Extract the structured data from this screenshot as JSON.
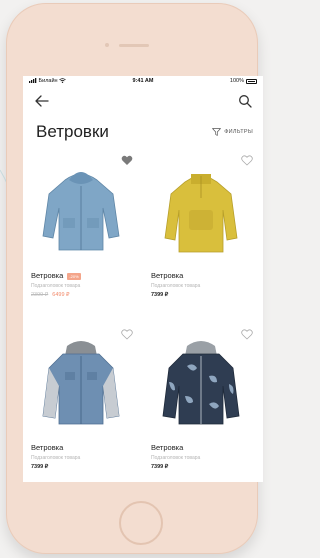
{
  "status_bar": {
    "carrier": "Билайн",
    "time": "9:41 AM",
    "battery": "100%"
  },
  "header": {
    "title": "Ветровки",
    "filter_label": "ФИЛЬТРЫ"
  },
  "products": [
    {
      "name": "Ветровка",
      "subtitle": "Подзаголовок товара",
      "badge": "-20%",
      "old_price": "2399 ₽",
      "price": "6499 ₽",
      "favorited": true
    },
    {
      "name": "Ветровка",
      "subtitle": "Подзаголовок товара",
      "price": "7399 ₽",
      "favorited": false
    },
    {
      "name": "Ветровка",
      "subtitle": "Подзаголовок товара",
      "price": "7399 ₽",
      "favorited": false
    },
    {
      "name": "Ветровка",
      "subtitle": "Подзаголовок товара",
      "price": "7399 ₽",
      "favorited": false
    }
  ],
  "colors": {
    "phone_body": "#f3ddd0",
    "accent_price": "#f28a6b",
    "badge": "#f4a58a",
    "favorite_active": "#7a7a7a"
  }
}
